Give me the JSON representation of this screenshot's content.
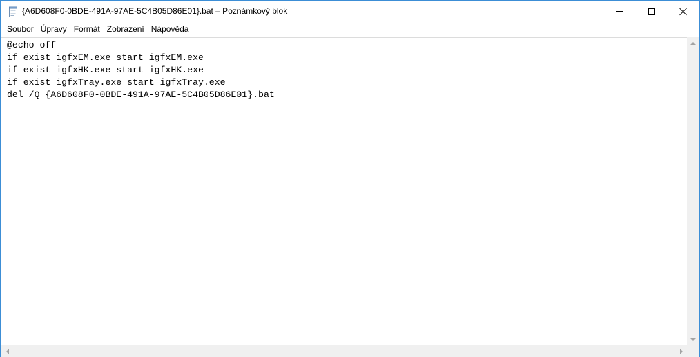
{
  "window": {
    "title": "{A6D608F0-0BDE-491A-97AE-5C4B05D86E01}.bat – Poznámkový blok",
    "icon": "notepad-icon",
    "controls": [
      "minimize-icon",
      "maximize-icon",
      "close-icon"
    ]
  },
  "menu": {
    "items": [
      {
        "label": "Soubor"
      },
      {
        "label": "Úpravy"
      },
      {
        "label": "Formát"
      },
      {
        "label": "Zobrazení"
      },
      {
        "label": "Nápověda"
      }
    ]
  },
  "editor": {
    "lines": [
      "@echo off",
      "if exist igfxEM.exe start igfxEM.exe",
      "if exist igfxHK.exe start igfxHK.exe",
      "if exist igfxTray.exe start igfxTray.exe",
      "del /Q {A6D608F0-0BDE-491A-97AE-5C4B05D86E01}.bat"
    ]
  },
  "colors": {
    "window_border": "#3c8ed6",
    "scrollbar_bg": "#f0f0f0",
    "scroll_arrow": "#a3a3a3"
  }
}
